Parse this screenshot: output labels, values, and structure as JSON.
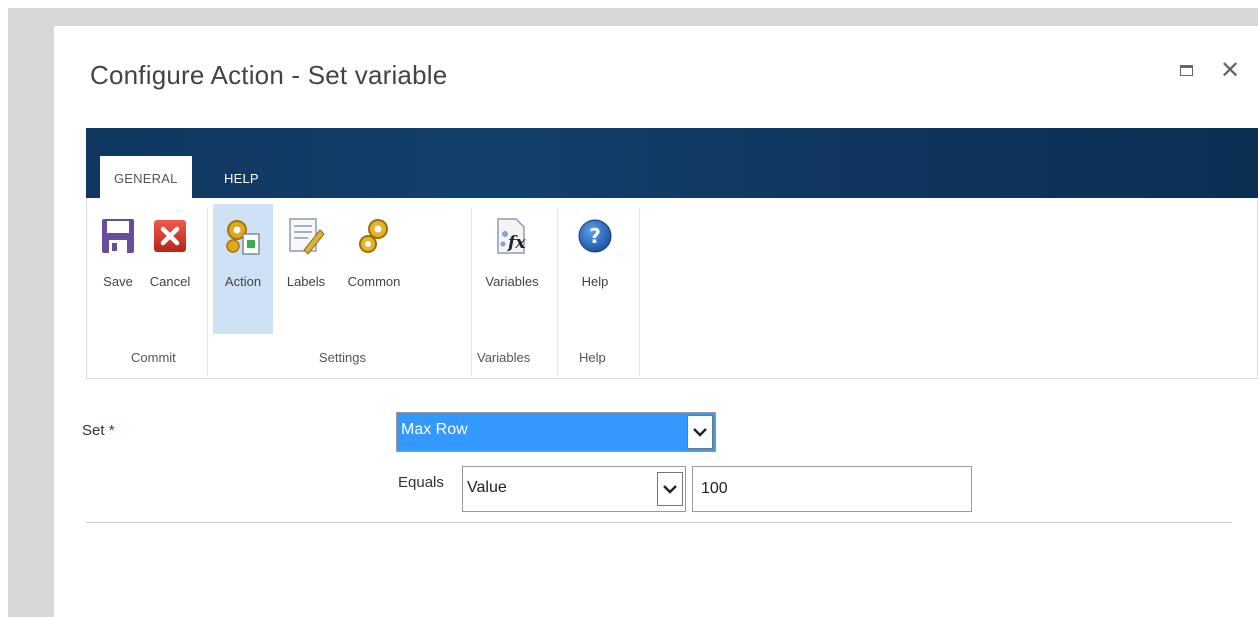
{
  "window": {
    "title": "Configure Action - Set variable",
    "close_glyph": "✕"
  },
  "tabs": [
    {
      "label": "GENERAL"
    },
    {
      "label": "HELP"
    }
  ],
  "ribbon": {
    "buttons": {
      "save": {
        "label": "Save",
        "icon": "save-icon"
      },
      "cancel": {
        "label": "Cancel",
        "icon": "cancel-icon"
      },
      "action": {
        "label": "Action",
        "icon": "action-gears-icon"
      },
      "labels": {
        "label": "Labels",
        "icon": "labels-icon"
      },
      "common": {
        "label": "Common",
        "icon": "common-gears-icon"
      },
      "variables": {
        "label": "Variables",
        "icon": "variables-fx-icon"
      },
      "help": {
        "label": "Help",
        "icon": "help-icon"
      }
    },
    "groups": {
      "commit": "Commit",
      "settings": "Settings",
      "variables": "Variables",
      "help": "Help"
    }
  },
  "form": {
    "set_label": "Set",
    "required_mark": "*",
    "set_value": "Max Row",
    "equals_label": "Equals",
    "equals_value": "Value",
    "value_input": "100"
  },
  "colors": {
    "ribbon_header": "#0f3760",
    "selection": "#3399ff",
    "active_button": "#cfe2f5",
    "required": "#cc0000"
  }
}
